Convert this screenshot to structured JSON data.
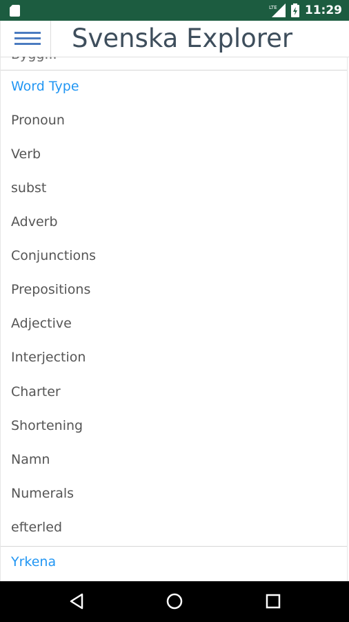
{
  "status_bar": {
    "time": "11:29",
    "sim_icon": "sim-card-icon",
    "network_label": "LTE",
    "network_icon": "signal-icon",
    "battery_icon": "battery-icon",
    "background_color": "#1c5c40"
  },
  "app_bar": {
    "title": "Svenska Explorer",
    "menu_icon": "hamburger-menu-icon",
    "accent_color": "#4b7bc0"
  },
  "drawer": {
    "cut_off_item": "Bygg...",
    "section_word_type": "Word Type",
    "word_types": [
      "Pronoun",
      "Verb",
      "subst",
      "Adverb",
      "Conjunctions",
      "Prepositions",
      "Adjective",
      "Interjection",
      "Charter",
      "Shortening",
      "Namn",
      "Numerals",
      "efterled"
    ],
    "section_yrkena": "Yrkena",
    "header_color": "#2196f3"
  },
  "nav_bar": {
    "back_icon": "back-triangle-icon",
    "home_icon": "home-circle-icon",
    "recents_icon": "recents-square-icon"
  }
}
